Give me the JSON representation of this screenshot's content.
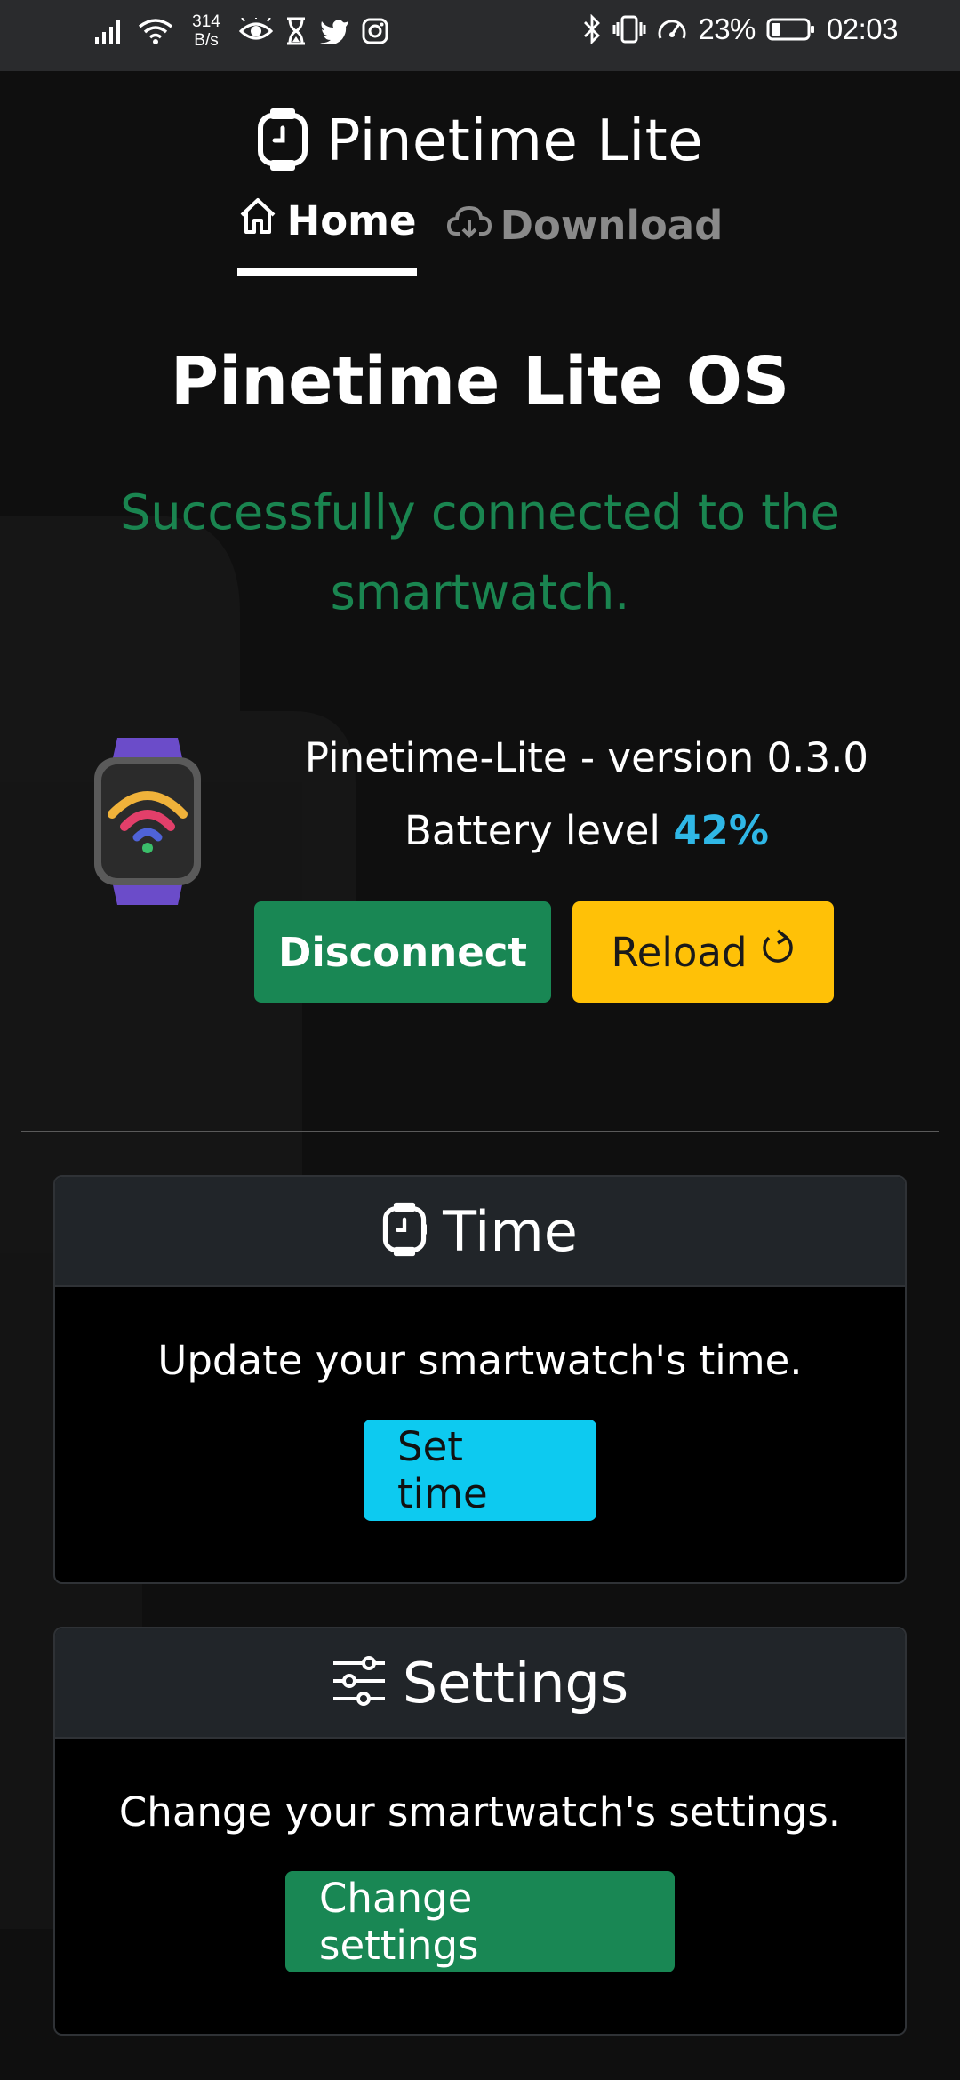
{
  "status_bar": {
    "net_speed_value": "314",
    "net_speed_unit": "B/s",
    "battery_percent": "23%",
    "time": "02:03",
    "icons": [
      "signal-icon",
      "wifi-icon",
      "eye-icon",
      "hourglass-icon",
      "twitter-icon",
      "instagram-icon",
      "bluetooth-icon",
      "vibrate-icon",
      "speedometer-icon",
      "battery-icon"
    ]
  },
  "nav": {
    "brand": "Pinetime Lite",
    "brand_icon": "watch-icon",
    "tabs": [
      {
        "label": "Home",
        "icon": "home-icon",
        "active": true
      },
      {
        "label": "Download",
        "icon": "cloud-download-icon",
        "active": false
      }
    ]
  },
  "hero": {
    "title": "Pinetime Lite OS",
    "status_message": "Successfully connected to the smartwatch.",
    "status_color": "#1a8550"
  },
  "device": {
    "version_text": "Pinetime-Lite - version 0.3.0",
    "battery_label": "Battery level",
    "battery_value": "42%",
    "image_icon": "smartwatch-wifi-icon"
  },
  "actions": {
    "disconnect_label": "Disconnect",
    "reload_label": "Reload",
    "reload_icon": "refresh-icon"
  },
  "cards": {
    "time": {
      "title": "Time",
      "icon": "watch-icon",
      "text": "Update your smartwatch's time.",
      "button": "Set time"
    },
    "settings": {
      "title": "Settings",
      "icon": "sliders-icon",
      "text": "Change your smartwatch's settings.",
      "button": "Change settings"
    }
  },
  "colors": {
    "success": "#198754",
    "warning": "#ffc107",
    "info": "#0dcaf0",
    "battery_accent": "#2fb7e6"
  }
}
